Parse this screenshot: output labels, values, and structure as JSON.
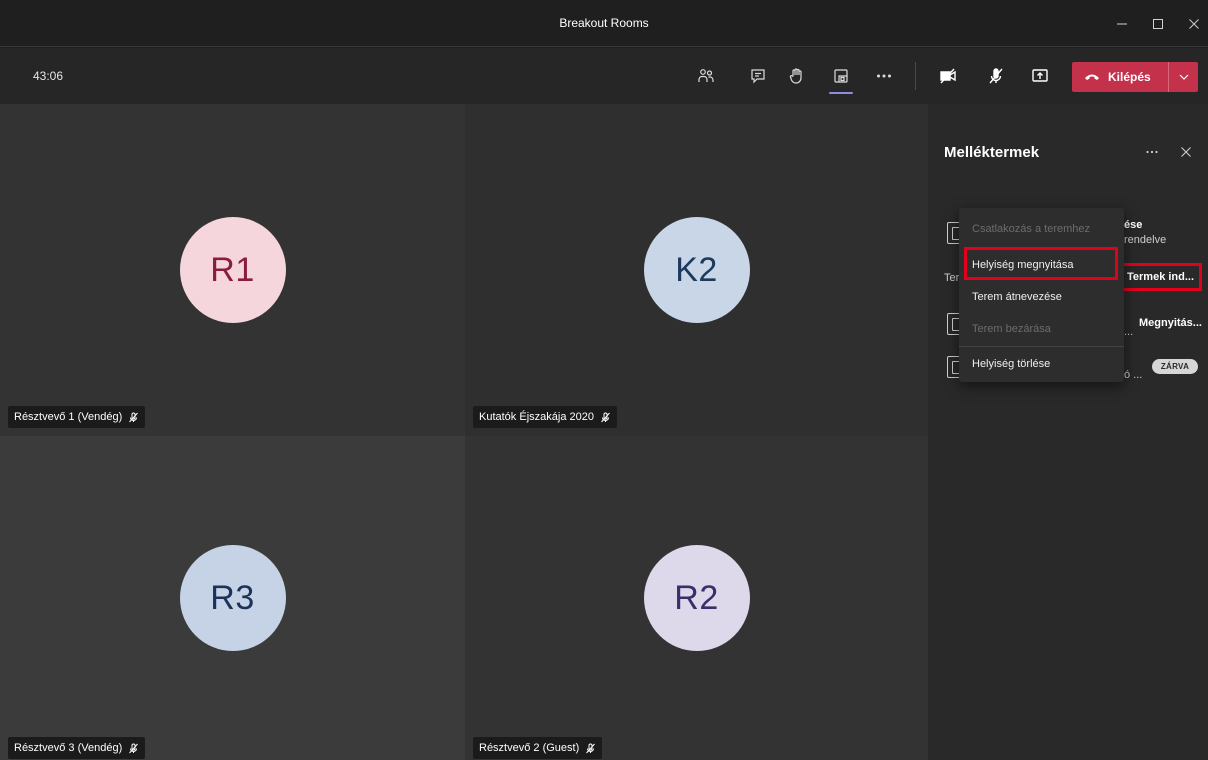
{
  "window": {
    "title": "Breakout Rooms"
  },
  "toolbar": {
    "timer": "43:06",
    "leave_label": "Kilépés",
    "icons": [
      "people-icon",
      "chat-icon",
      "raise-hand-icon",
      "breakout-rooms-icon",
      "more-icon",
      "camera-off-icon",
      "mic-off-icon",
      "share-icon"
    ]
  },
  "tiles": [
    {
      "initials": "R1",
      "name": "Résztvevő 1 (Vendég)",
      "bg": "#333333",
      "avatar_bg": "#f4d6dc",
      "avatar_fg": "#8a1d3e"
    },
    {
      "initials": "K2",
      "name": "Kutatók Éjszakája 2020",
      "bg": "#2f2f2f",
      "avatar_bg": "#c8d6e8",
      "avatar_fg": "#1b3a5c"
    },
    {
      "initials": "R3",
      "name": "Résztvevő 3 (Vendég)",
      "bg": "#3b3b3b",
      "avatar_bg": "#c6d3e6",
      "avatar_fg": "#1b3358"
    },
    {
      "initials": "R2",
      "name": "Résztvevő 2 (Guest)",
      "bg": "#333333",
      "avatar_bg": "#ddd8ea",
      "avatar_fg": "#3c2e6b"
    }
  ],
  "panel": {
    "title": "Melléktermek",
    "header_right_1": "ése",
    "header_right_2": "rendelve",
    "rooms_label_partial": "Ter",
    "start_rooms_button": "Termek ind...",
    "open_link": "Megnyitás...",
    "room1_partial": "...",
    "room2_partial": "ó ...",
    "closed_badge": "ZÁRVA"
  },
  "context_menu": {
    "items": [
      {
        "label": "Csatlakozás a teremhez",
        "enabled": false
      },
      {
        "label": "Helyiség megnyitása",
        "enabled": true
      },
      {
        "label": "Terem átnevezése",
        "enabled": true
      },
      {
        "label": "Terem bezárása",
        "enabled": false
      },
      {
        "label": "Helyiség törlése",
        "enabled": true
      }
    ]
  },
  "colors": {
    "accent": "#8c8fe0",
    "leave": "#c4314b",
    "highlight": "#e3001b"
  }
}
